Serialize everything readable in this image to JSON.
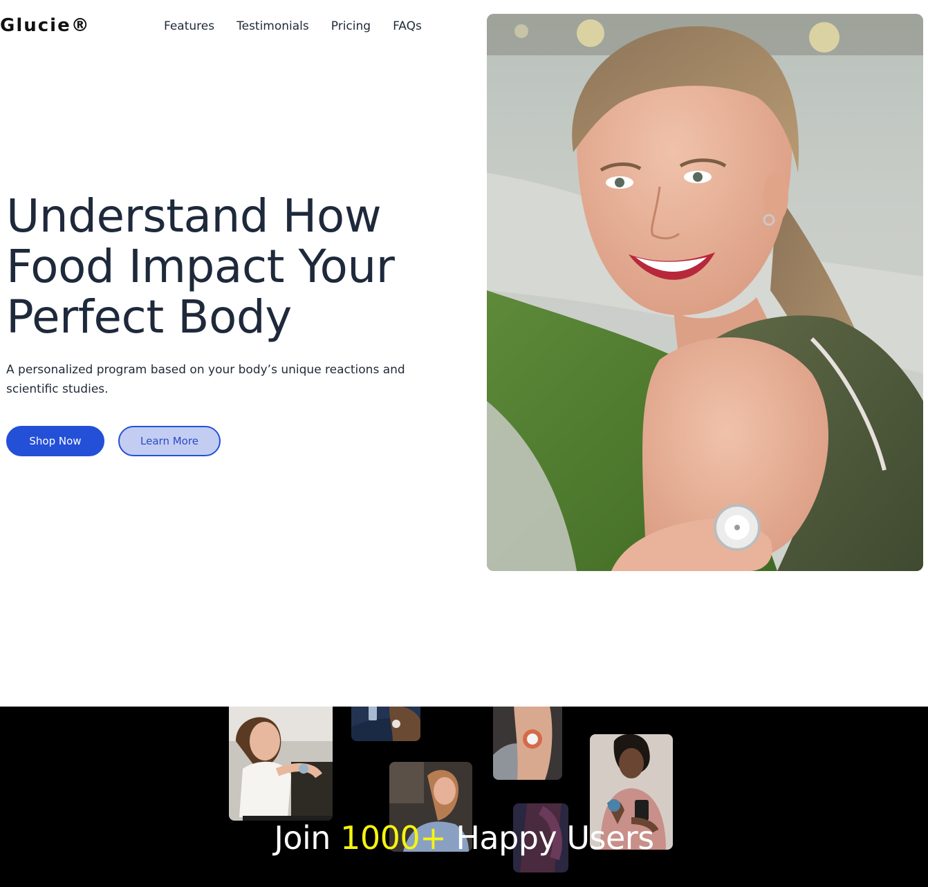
{
  "header": {
    "logo": "Glucie®",
    "nav": [
      "Features",
      "Testimonials",
      "Pricing",
      "FAQs"
    ]
  },
  "hero": {
    "title_lines": [
      "Understand How",
      "Food Impact Your",
      "Perfect Body"
    ],
    "subtitle": "A personalized program based on your body’s unique reactions and scientific studies.",
    "primary_button": "Shop Now",
    "secondary_button": "Learn More",
    "image": "smiling-woman-with-glucose-sensor-photo"
  },
  "social_proof": {
    "title_prefix": "Join ",
    "title_highlight": "1000+",
    "title_suffix": " Happy Users",
    "highlight_color": "#f5f40f",
    "photos": [
      "user-photo-kitchen",
      "user-photo-phone-arm",
      "user-photo-woman-laptop",
      "user-photo-sensor-arm",
      "user-photo-smiling-phone",
      "user-photo-arm-closeup"
    ]
  },
  "colors": {
    "accent": "#2450d8",
    "accent_light": "#c3cdf2",
    "heading": "#1e293b",
    "dark_bg": "#000000"
  }
}
